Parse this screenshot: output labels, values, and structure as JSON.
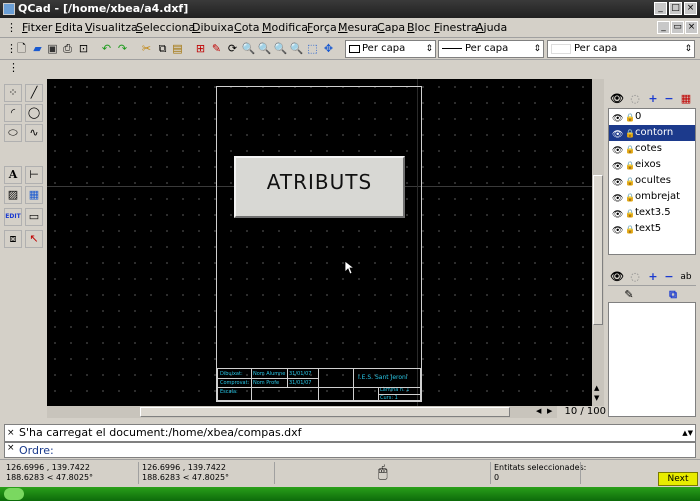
{
  "window": {
    "title": "QCad - [/home/xbea/a4.dxf]"
  },
  "menu": [
    "Fitxer",
    "Edita",
    "Visualitza",
    "Selecciona",
    "Dibuixa",
    "Cota",
    "Modifica",
    "Força",
    "Mesura",
    "Capa",
    "Bloc",
    "Finestra",
    "Ajuda"
  ],
  "toolbar": {
    "combo_color": "Per capa",
    "combo_width": "Per capa",
    "combo_linetype": "Per capa"
  },
  "canvas": {
    "button_label": "ATRIBUTS",
    "title_block": {
      "dibuixat": "Dibuixat:",
      "comprovat": "Comprovat:",
      "escala": "Escala:",
      "dibuixat_nom": "Nom Alumne",
      "comprovat_nom": "Nom Profe",
      "dibuixat_data": "31/01/07",
      "comprovat_data": "31/01/07",
      "lamina": "Làmina n. 1",
      "curs": "Curs: 1",
      "school": "I.E.S. Sant Jeroni"
    }
  },
  "page_indicator": "10 / 100",
  "layers": [
    {
      "name": "0"
    },
    {
      "name": "contorn",
      "selected": true
    },
    {
      "name": "cotes"
    },
    {
      "name": "eixos"
    },
    {
      "name": "ocultes"
    },
    {
      "name": "ombrejat"
    },
    {
      "name": "text3.5"
    },
    {
      "name": "text5"
    }
  ],
  "command": {
    "message": "S'ha carregat el document:/home/xbea/compas.dxf",
    "prompt_label": "Ordre:"
  },
  "status": {
    "coord1_abs": "126.6996 , 139.7422",
    "coord1_pol": "188.6283 < 47.8025°",
    "coord2_abs": "126.6996 , 139.7422",
    "coord2_pol": "188.6283 < 47.8025°",
    "selected_label": "Entitats seleccionades:",
    "selected_count": "0",
    "next_label": "Next"
  },
  "colors": {
    "accent": "#1c3a8c",
    "canvas": "#000000",
    "title_text": "#28c8e8"
  }
}
